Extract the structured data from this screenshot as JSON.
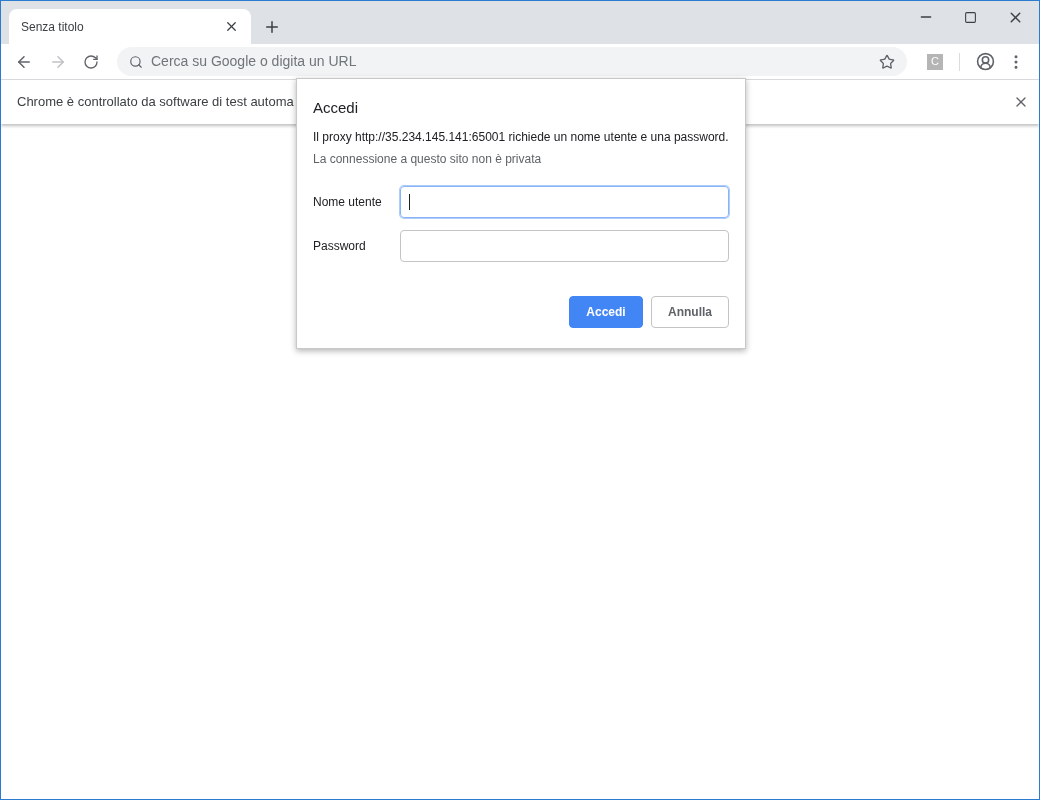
{
  "tabs": [
    {
      "title": "Senza titolo",
      "selected": true
    }
  ],
  "toolbar": {
    "back_enabled": true,
    "forward_enabled": false,
    "omnibox_placeholder": "Cerca su Google o digita un URL",
    "extension_letter": "C"
  },
  "infobar": {
    "text": "Chrome è controllato da software di test automa"
  },
  "dialog": {
    "title": "Accedi",
    "message": "Il proxy http://35.234.145.141:65001 richiede un nome utente e una password.",
    "warning": "La connessione a questo sito non è privata",
    "fields": [
      {
        "label": "Nome utente",
        "focused": true
      },
      {
        "label": "Password",
        "focused": false
      }
    ],
    "buttons": [
      {
        "label": "Accedi",
        "kind": "primary"
      },
      {
        "label": "Annulla",
        "kind": "secondary"
      }
    ]
  }
}
